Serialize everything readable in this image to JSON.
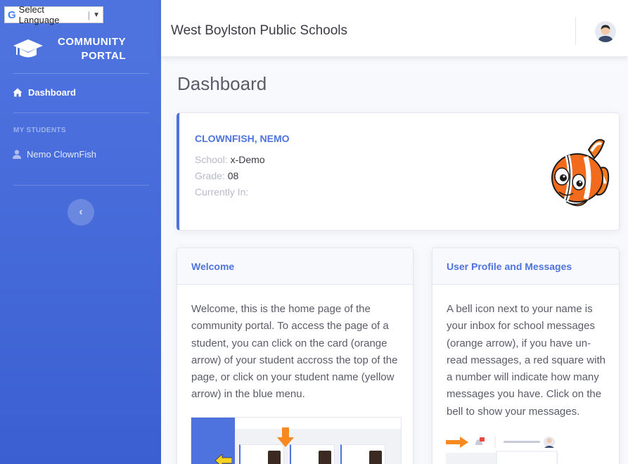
{
  "language_widget": {
    "label": "Select Language",
    "arrow": "▼",
    "icon": "google-g-icon"
  },
  "sidebar": {
    "brand_line1": "COMMUNITY",
    "brand_line2": "PORTAL",
    "brand_icon": "graduation-cap-icon",
    "nav": [
      {
        "label": "Dashboard",
        "icon": "home-icon",
        "active": true
      }
    ],
    "section_heading": "MY STUDENTS",
    "students": [
      {
        "label": "Nemo ClownFish",
        "icon": "user-icon"
      }
    ],
    "toggle_glyph": "‹"
  },
  "topbar": {
    "school_name": "West Boylston Public Schools",
    "avatar_icon": "user-avatar-icon"
  },
  "page": {
    "title": "Dashboard"
  },
  "student_card": {
    "name": "CLOWNFISH, NEMO",
    "school_label": "School:",
    "school_value": "x-Demo",
    "grade_label": "Grade:",
    "grade_value": "08",
    "currently_label": "Currently In:",
    "currently_value": ""
  },
  "welcome_card": {
    "title": "Welcome",
    "body": "Welcome, this is the home page of the community portal. To access the page of a student, you can click on the card (orange arrow) of your student accross the top of the page, or click on your student name (yellow arrow) in the blue menu."
  },
  "profile_card": {
    "title": "User Profile and Messages",
    "body": "A bell icon next to your name is your inbox for school messages (orange arrow), if you have un-read messages, a red square with a number will indicate how many messages you have. Click on the bell to show your messages."
  },
  "colors": {
    "primary": "#4e73df",
    "sidebar_bg": "#4e73df",
    "accent_orange": "#f6891f",
    "accent_yellow": "#f6d21f",
    "text": "#5a5c69"
  }
}
